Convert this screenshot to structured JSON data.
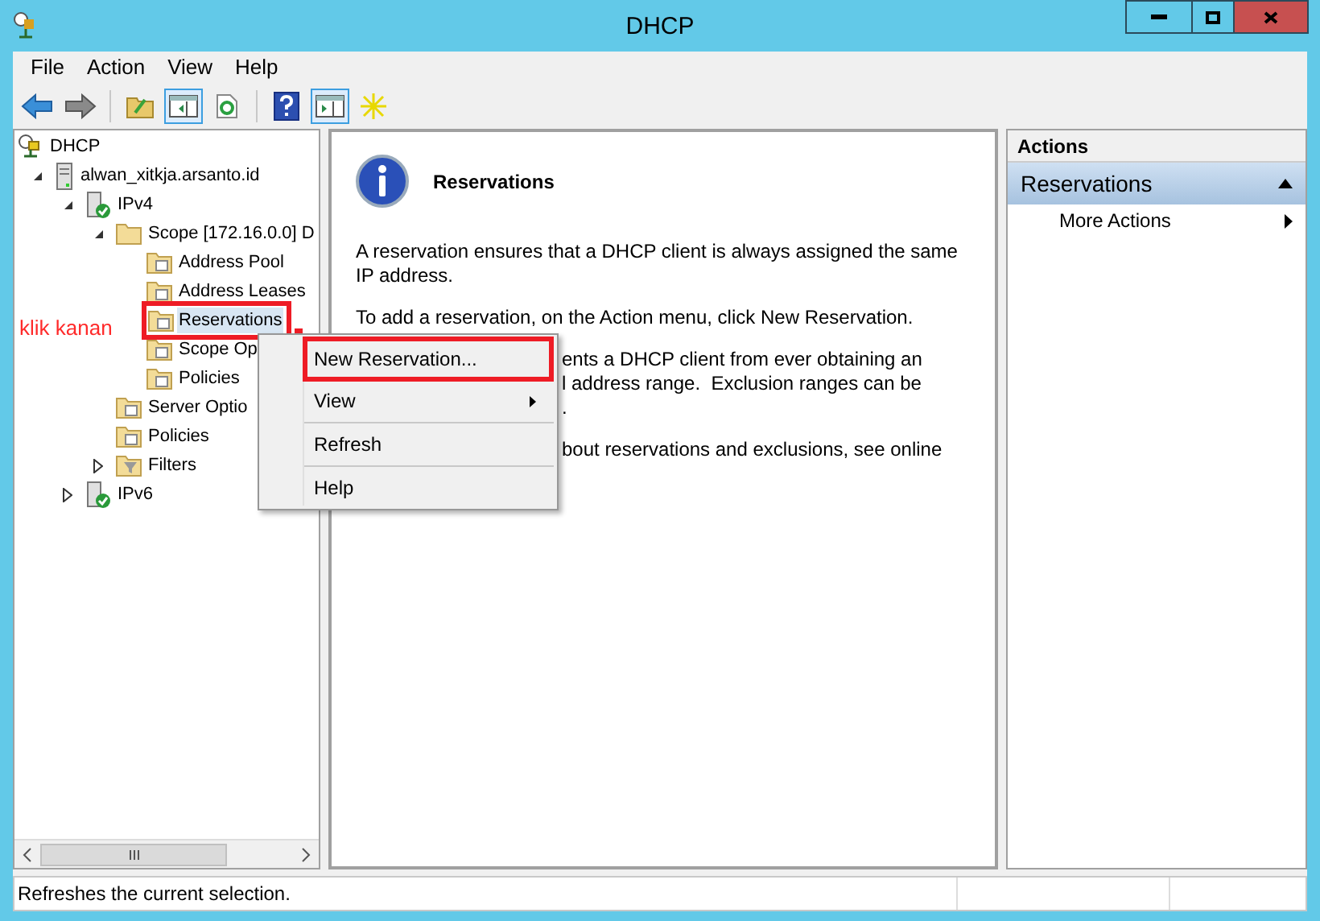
{
  "window": {
    "title": "DHCP"
  },
  "menu_bar": [
    "File",
    "Action",
    "View",
    "Help"
  ],
  "toolbar": [
    {
      "kind": "back",
      "pressed": false
    },
    {
      "kind": "forward",
      "pressed": false
    },
    {
      "kind": "sep"
    },
    {
      "kind": "up",
      "pressed": false
    },
    {
      "kind": "pane-left",
      "pressed": true
    },
    {
      "kind": "refresh",
      "pressed": false
    },
    {
      "kind": "sep"
    },
    {
      "kind": "help",
      "pressed": false
    },
    {
      "kind": "pane-right",
      "pressed": true
    },
    {
      "kind": "star",
      "pressed": false
    }
  ],
  "tree": [
    {
      "label": "DHCP",
      "kind": "root",
      "selected": false,
      "annotated": false,
      "children": [
        {
          "label": "alwan_xitkja.arsanto.id",
          "kind": "server",
          "expanded": true,
          "selected": false,
          "annotated": false,
          "children": [
            {
              "label": "IPv4",
              "kind": "protocol",
              "expanded": true,
              "selected": false,
              "annotated": false,
              "children": [
                {
                  "label": "Scope [172.16.0.0] D",
                  "kind": "folder",
                  "expanded": true,
                  "selected": false,
                  "annotated": false,
                  "children": [
                    {
                      "label": "Address Pool",
                      "kind": "folder-doc",
                      "selected": false,
                      "annotated": false
                    },
                    {
                      "label": "Address Leases",
                      "kind": "folder-doc",
                      "selected": false,
                      "annotated": false
                    },
                    {
                      "label": "Reservations",
                      "kind": "folder-doc",
                      "selected": true,
                      "annotated": true
                    },
                    {
                      "label": "Scope Op",
                      "kind": "folder-doc",
                      "selected": false,
                      "annotated": false
                    },
                    {
                      "label": "Policies",
                      "kind": "folder-doc",
                      "selected": false,
                      "annotated": false
                    }
                  ]
                },
                {
                  "label": "Server Optio",
                  "kind": "folder-doc",
                  "selected": false,
                  "annotated": false
                },
                {
                  "label": "Policies",
                  "kind": "folder-doc",
                  "selected": false,
                  "annotated": false
                },
                {
                  "label": "Filters",
                  "kind": "folder-filter",
                  "expanded": false,
                  "selected": false,
                  "annotated": false
                }
              ]
            },
            {
              "label": "IPv6",
              "kind": "protocol",
              "expanded": false,
              "selected": false,
              "annotated": false
            }
          ]
        }
      ]
    }
  ],
  "annotation": {
    "label": "klik kanan"
  },
  "context_menu": [
    {
      "kind": "item",
      "label": "New Reservation...",
      "annotated": true
    },
    {
      "kind": "submenu",
      "label": "View",
      "annotated": false
    },
    {
      "kind": "separator"
    },
    {
      "kind": "item",
      "label": "Refresh",
      "annotated": false
    },
    {
      "kind": "separator"
    },
    {
      "kind": "item",
      "label": "Help",
      "annotated": false
    }
  ],
  "content": {
    "title": "Reservations",
    "paragraphs": [
      {
        "kind": "full",
        "lines": [
          "A reservation ensures that a DHCP client is always assigned the same",
          "IP address."
        ]
      },
      {
        "kind": "full",
        "lines": [
          "To add a reservation, on the Action menu, click New Reservation."
        ]
      },
      {
        "kind": "partial",
        "lines": [
          "ents a DHCP client from ever obtaining an",
          "l address range.  Exclusion ranges can be",
          "."
        ]
      },
      {
        "kind": "partial",
        "lines": [
          "bout reservations and exclusions, see online"
        ]
      }
    ]
  },
  "actions": {
    "header": "Actions",
    "section": {
      "title": "Reservations",
      "expanded": true
    },
    "items": [
      {
        "label": "More Actions"
      }
    ]
  },
  "status_bar": {
    "text": "Refreshes the current selection."
  }
}
